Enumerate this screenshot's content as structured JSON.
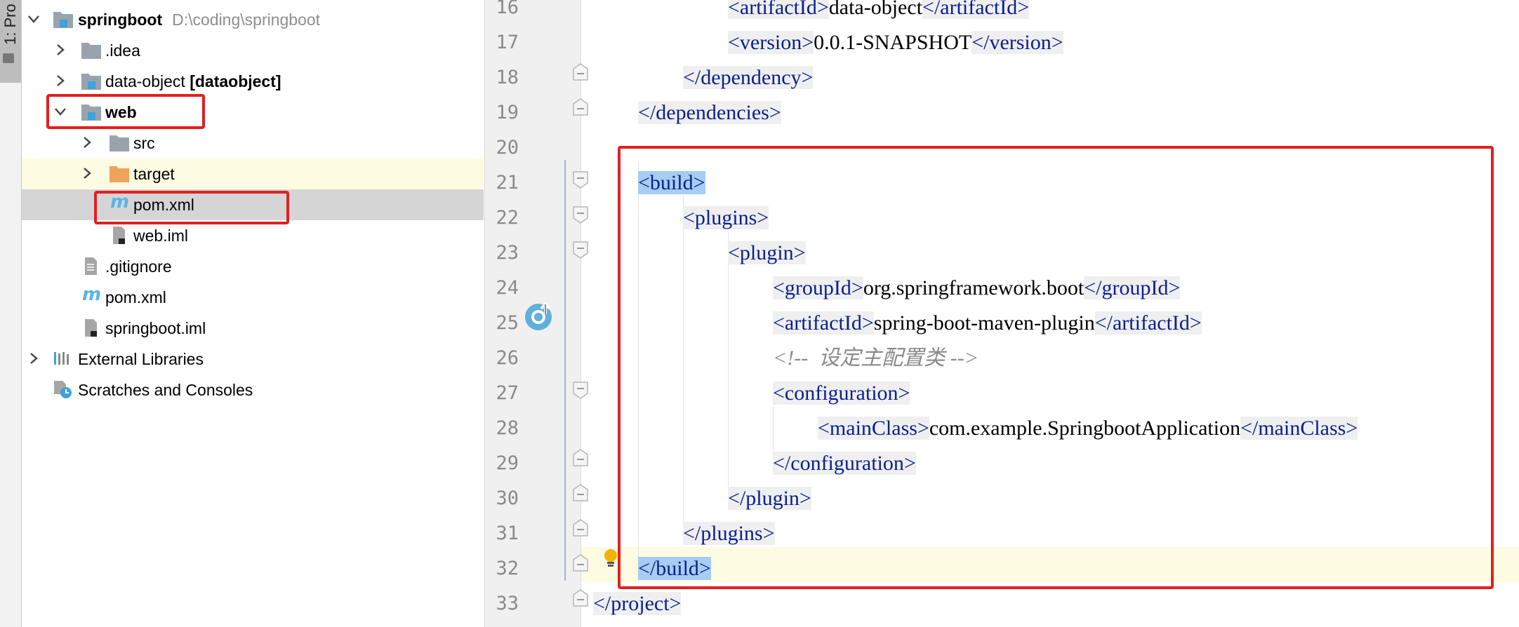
{
  "tool_window": {
    "tab_label": "1: Pro"
  },
  "project_tree": {
    "rows": [
      {
        "label": "springboot",
        "hint": "D:\\coding\\springboot"
      },
      {
        "label": ".idea"
      },
      {
        "label": "data-object",
        "module": "[dataobject]"
      },
      {
        "label": "web"
      },
      {
        "label": "src"
      },
      {
        "label": "target"
      },
      {
        "label": "pom.xml"
      },
      {
        "label": "web.iml"
      },
      {
        "label": ".gitignore"
      },
      {
        "label": "pom.xml"
      },
      {
        "label": "springboot.iml"
      },
      {
        "label": "External Libraries"
      },
      {
        "label": "Scratches and Consoles"
      }
    ]
  },
  "editor": {
    "line_numbers": [
      "16",
      "17",
      "18",
      "19",
      "20",
      "21",
      "22",
      "23",
      "24",
      "25",
      "26",
      "27",
      "28",
      "29",
      "30",
      "31",
      "32",
      "33"
    ],
    "lines": {
      "l16": {
        "open": "<artifactId>",
        "text": "data-object",
        "close": "</artifactId>"
      },
      "l17": {
        "open": "<version>",
        "text": "0.0.1-SNAPSHOT",
        "close": "</version>"
      },
      "l18": {
        "tag": "</dependency>"
      },
      "l19": {
        "tag": "</dependencies>"
      },
      "l21": {
        "tag": "<build>"
      },
      "l22": {
        "tag": "<plugins>"
      },
      "l23": {
        "tag": "<plugin>"
      },
      "l24": {
        "open": "<groupId>",
        "text": "org.springframework.boot",
        "close": "</groupId>"
      },
      "l25": {
        "open": "<artifactId>",
        "text": "spring-boot-maven-plugin",
        "close": "</artifactId>"
      },
      "l26": {
        "comment": "<!--  设定主配置类 -->"
      },
      "l27": {
        "tag": "<configuration>"
      },
      "l28": {
        "open": "<mainClass>",
        "text": "com.example.SpringbootApplication",
        "close": "</mainClass>"
      },
      "l29": {
        "tag": "</configuration>"
      },
      "l30": {
        "tag": "</plugin>"
      },
      "l31": {
        "tag": "</plugins>"
      },
      "l32": {
        "tag": "</build>"
      },
      "l33": {
        "tag": "</project>"
      }
    }
  },
  "colors": {
    "annotation_red": "#e02020",
    "xml_tag": "#0a1f8f",
    "selection": "#a6cdf2",
    "current_line": "#fdfbe2"
  }
}
